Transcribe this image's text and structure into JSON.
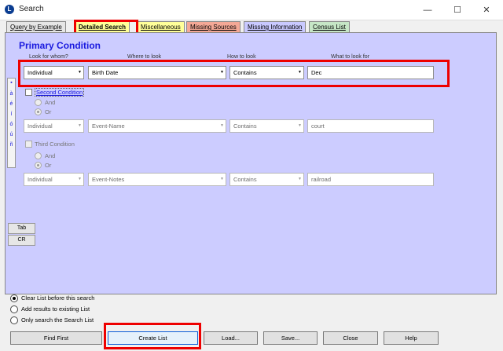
{
  "window": {
    "title": "Search",
    "app_icon_letter": "L",
    "minimize": "—",
    "maximize": "☐",
    "close": "✕"
  },
  "tabs": [
    {
      "label": "Query by Example",
      "active": false,
      "color": "#e6e6e6"
    },
    {
      "label": "Detailed Search",
      "active": true,
      "color": "#ffff99"
    },
    {
      "label": "Miscellaneous",
      "active": false,
      "color": "#ffff99"
    },
    {
      "label": "Missing Sources",
      "active": false,
      "color": "#f4a896"
    },
    {
      "label": "Missing Information",
      "active": false,
      "color": "#c9c9ff"
    },
    {
      "label": "Census List",
      "active": false,
      "color": "#c6e6c6"
    }
  ],
  "panel": {
    "heading": "Primary Condition",
    "columns": [
      "Look for whom?",
      "Where to look",
      "How to look",
      "What to look for"
    ]
  },
  "primary": {
    "whom": "Individual",
    "where": "Birth Date",
    "how": "Contains",
    "what": "Dec"
  },
  "second": {
    "label": "Second Condition",
    "and_label": "And",
    "or_label": "Or",
    "whom": "Individual",
    "where": "Event-Name",
    "how": "Contains",
    "what": "court"
  },
  "third": {
    "label": "Third Condition",
    "and_label": "And",
    "or_label": "Or",
    "whom": "Individual",
    "where": "Event-Notes",
    "how": "Contains",
    "what": "railroad"
  },
  "charbar": [
    "▪",
    "à",
    "é",
    "í",
    "ó",
    "ú",
    "ñ"
  ],
  "side_buttons": {
    "tab": "Tab",
    "cr": "CR"
  },
  "list_options": [
    {
      "label": "Clear List before this search",
      "selected": true
    },
    {
      "label": "Add results to existing List",
      "selected": false
    },
    {
      "label": "Only search the Search List",
      "selected": false
    }
  ],
  "buttons": {
    "find_first": "Find First",
    "create_list": "Create List",
    "load": "Load...",
    "save": "Save...",
    "close": "Close",
    "help": "Help"
  },
  "dropdown_arrow": "▼",
  "colors": {
    "panel_bg": "#ccccff",
    "heading": "#1a1adf",
    "highlight": "#e00000"
  }
}
